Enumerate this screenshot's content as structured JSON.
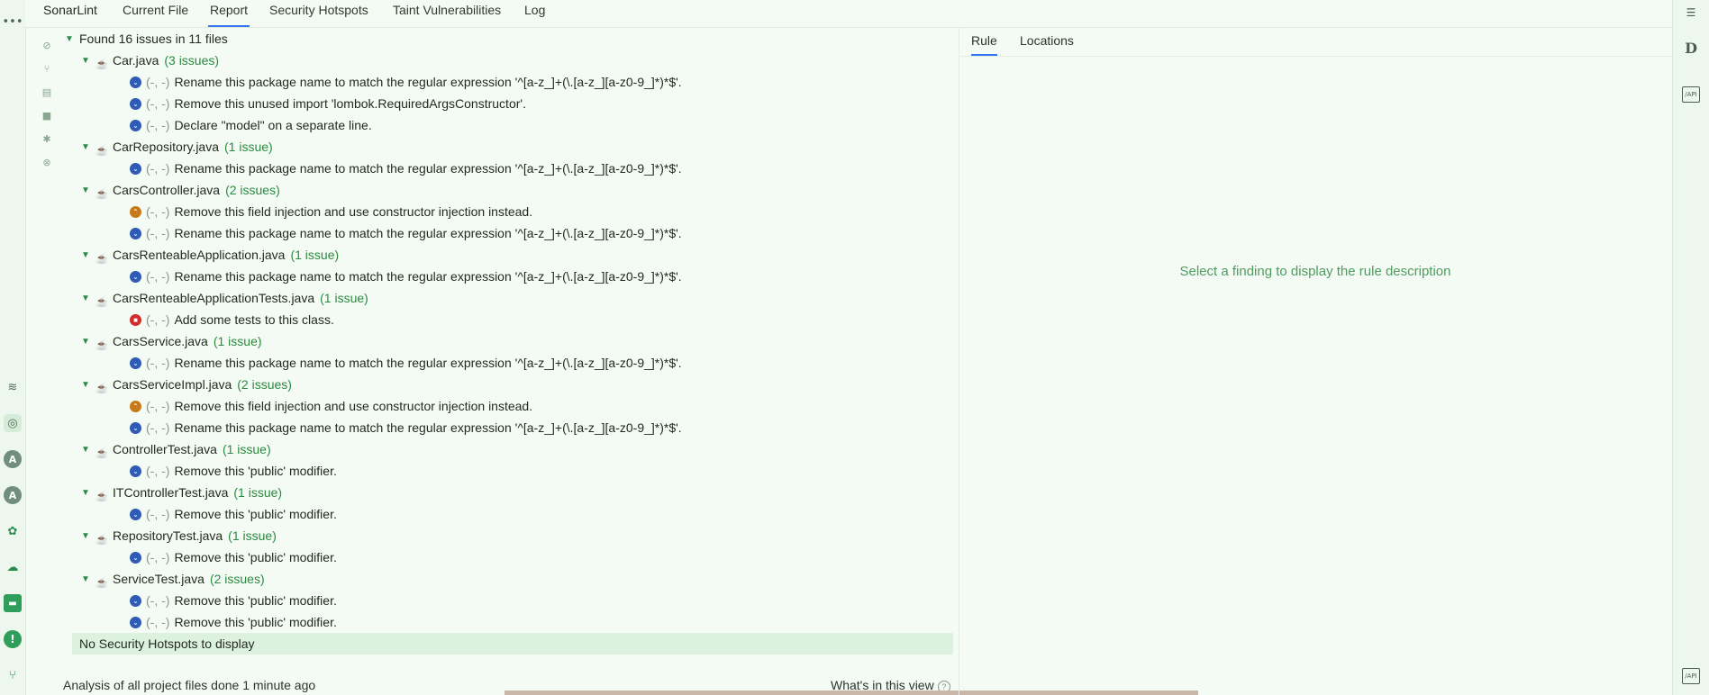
{
  "tabs": {
    "app": "SonarLint",
    "current_file": "Current File",
    "report": "Report",
    "security_hotspots": "Security Hotspots",
    "taint": "Taint Vulnerabilities",
    "log": "Log"
  },
  "summary": "Found 16 issues in 11 files",
  "files": [
    {
      "name": "Car.java",
      "count": "(3 issues)",
      "issues": [
        {
          "severity": "minor",
          "loc": "(-, -)",
          "msg": "Rename this package name to match the regular expression '^[a-z_]+(\\.[a-z_][a-z0-9_]*)*$'."
        },
        {
          "severity": "minor",
          "loc": "(-, -)",
          "msg": "Remove this unused import 'lombok.RequiredArgsConstructor'."
        },
        {
          "severity": "minor",
          "loc": "(-, -)",
          "msg": "Declare \"model\" on a separate line."
        }
      ]
    },
    {
      "name": "CarRepository.java",
      "count": "(1 issue)",
      "issues": [
        {
          "severity": "minor",
          "loc": "(-, -)",
          "msg": "Rename this package name to match the regular expression '^[a-z_]+(\\.[a-z_][a-z0-9_]*)*$'."
        }
      ]
    },
    {
      "name": "CarsController.java",
      "count": "(2 issues)",
      "issues": [
        {
          "severity": "major",
          "loc": "(-, -)",
          "msg": "Remove this field injection and use constructor injection instead."
        },
        {
          "severity": "minor",
          "loc": "(-, -)",
          "msg": "Rename this package name to match the regular expression '^[a-z_]+(\\.[a-z_][a-z0-9_]*)*$'."
        }
      ]
    },
    {
      "name": "CarsRenteableApplication.java",
      "count": "(1 issue)",
      "issues": [
        {
          "severity": "minor",
          "loc": "(-, -)",
          "msg": "Rename this package name to match the regular expression '^[a-z_]+(\\.[a-z_][a-z0-9_]*)*$'."
        }
      ]
    },
    {
      "name": "CarsRenteableApplicationTests.java",
      "count": "(1 issue)",
      "issues": [
        {
          "severity": "blocker",
          "loc": "(-, -)",
          "msg": "Add some tests to this class."
        }
      ]
    },
    {
      "name": "CarsService.java",
      "count": "(1 issue)",
      "issues": [
        {
          "severity": "minor",
          "loc": "(-, -)",
          "msg": "Rename this package name to match the regular expression '^[a-z_]+(\\.[a-z_][a-z0-9_]*)*$'."
        }
      ]
    },
    {
      "name": "CarsServiceImpl.java",
      "count": "(2 issues)",
      "issues": [
        {
          "severity": "major",
          "loc": "(-, -)",
          "msg": "Remove this field injection and use constructor injection instead."
        },
        {
          "severity": "minor",
          "loc": "(-, -)",
          "msg": "Rename this package name to match the regular expression '^[a-z_]+(\\.[a-z_][a-z0-9_]*)*$'."
        }
      ]
    },
    {
      "name": "ControllerTest.java",
      "count": "(1 issue)",
      "issues": [
        {
          "severity": "minor",
          "loc": "(-, -)",
          "msg": "Remove this 'public' modifier."
        }
      ]
    },
    {
      "name": "ITControllerTest.java",
      "count": "(1 issue)",
      "issues": [
        {
          "severity": "minor",
          "loc": "(-, -)",
          "msg": "Remove this 'public' modifier."
        }
      ]
    },
    {
      "name": "RepositoryTest.java",
      "count": "(1 issue)",
      "issues": [
        {
          "severity": "minor",
          "loc": "(-, -)",
          "msg": "Remove this 'public' modifier."
        }
      ]
    },
    {
      "name": "ServiceTest.java",
      "count": "(2 issues)",
      "issues": [
        {
          "severity": "minor",
          "loc": "(-, -)",
          "msg": "Remove this 'public' modifier."
        },
        {
          "severity": "minor",
          "loc": "(-, -)",
          "msg": "Remove this 'public' modifier."
        }
      ]
    }
  ],
  "hotspots_message": "No Security Hotspots to display",
  "footer": {
    "status": "Analysis of all project files done 1 minute ago",
    "whats_new": "What's in this view",
    "help_icon": "?"
  },
  "rule_panel": {
    "tab_rule": "Rule",
    "tab_locations": "Locations",
    "empty_message": "Select a finding to display the rule description"
  },
  "right_bar": {
    "d_label": "D",
    "api_label": "/API"
  },
  "colors": {
    "accent": "#3574f0",
    "count_green": "#2b8a3f",
    "minor": "#2f5bb7",
    "major": "#c77a1b",
    "blocker": "#d12b2b"
  }
}
